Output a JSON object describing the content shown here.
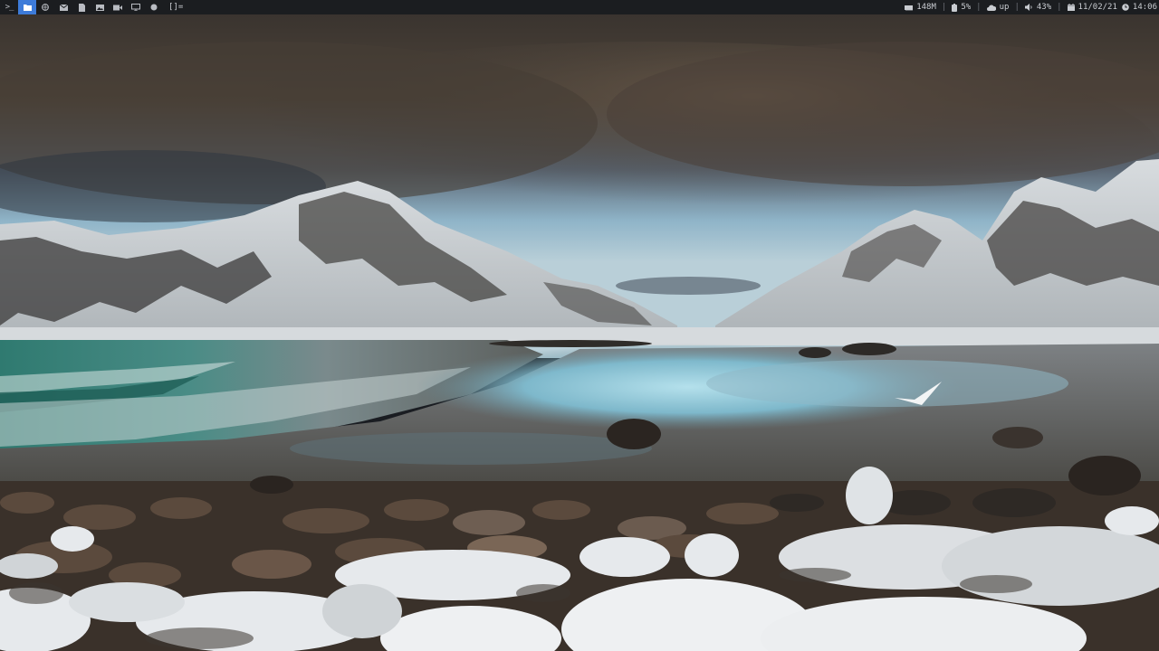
{
  "topbar": {
    "terminal_glyph": ">_",
    "layout_symbol": "[]=",
    "workspaces": [
      {
        "icon": "terminal-icon",
        "active": false
      },
      {
        "icon": "folder-icon",
        "active": true
      },
      {
        "icon": "globe-icon",
        "active": false
      },
      {
        "icon": "mail-icon",
        "active": false
      },
      {
        "icon": "document-icon",
        "active": false
      },
      {
        "icon": "image-icon",
        "active": false
      },
      {
        "icon": "video-icon",
        "active": false
      },
      {
        "icon": "monitor-icon",
        "active": false
      },
      {
        "icon": "circle-icon",
        "active": false
      }
    ],
    "status": {
      "memory": "148M",
      "cpu": "5%",
      "network": "up",
      "volume": "43%",
      "date": "11/02/21",
      "time": "14:06"
    }
  },
  "wallpaper": {
    "scene": "snowy-mountain-beach",
    "colors": {
      "sky_cloud": "#4a4036",
      "sky_blue": "#8fb4c8",
      "snow": "#e6e9ec",
      "sea": "#2e6e68",
      "water_reflection": "#9fd0e0",
      "rocks": "#3e342b"
    }
  }
}
